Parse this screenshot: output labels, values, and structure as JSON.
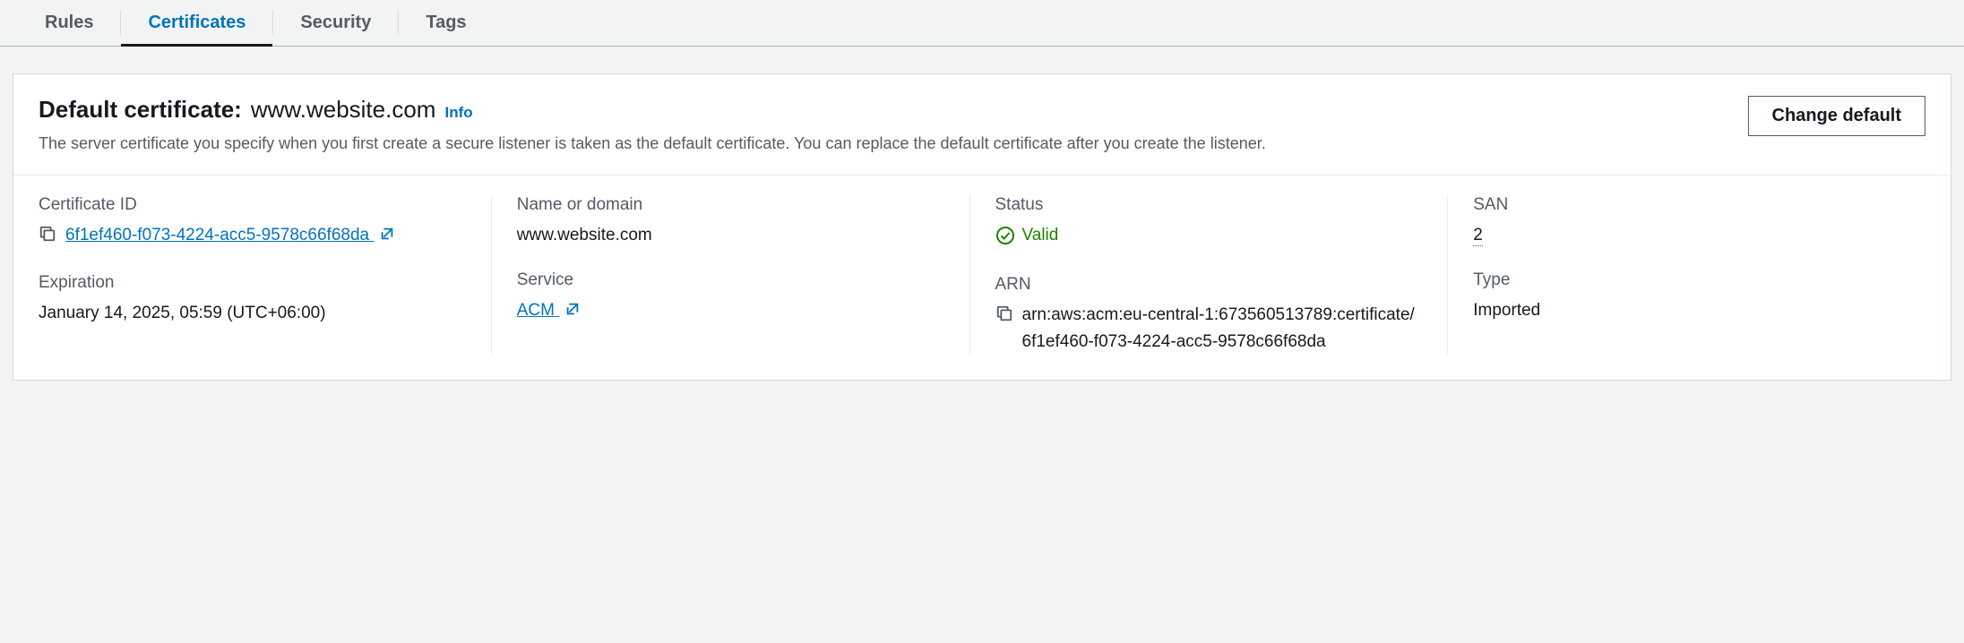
{
  "tabs": {
    "rules": "Rules",
    "certificates": "Certificates",
    "security": "Security",
    "tags": "Tags"
  },
  "header": {
    "title_prefix": "Default certificate:",
    "title_domain": "www.website.com",
    "info": "Info",
    "description": "The server certificate you specify when you first create a secure listener is taken as the default certificate. You can replace the default certificate after you create the listener.",
    "change_button": "Change default"
  },
  "fields": {
    "cert_id": {
      "label": "Certificate ID",
      "value": "6f1ef460-f073-4224-acc5-9578c66f68da"
    },
    "expiration": {
      "label": "Expiration",
      "value": "January 14, 2025, 05:59 (UTC+06:00)"
    },
    "name": {
      "label": "Name or domain",
      "value": "www.website.com"
    },
    "service": {
      "label": "Service",
      "value": "ACM"
    },
    "status": {
      "label": "Status",
      "value": "Valid"
    },
    "arn": {
      "label": "ARN",
      "value": "arn:aws:acm:eu-central-1:673560513789:certificate/6f1ef460-f073-4224-acc5-9578c66f68da"
    },
    "san": {
      "label": "SAN",
      "value": "2"
    },
    "type": {
      "label": "Type",
      "value": "Imported"
    }
  }
}
